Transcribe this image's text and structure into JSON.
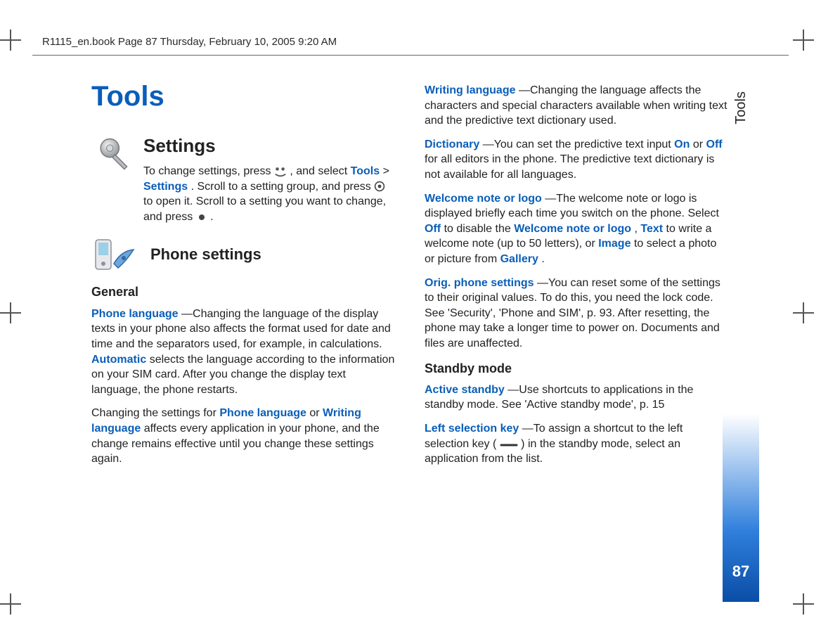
{
  "header": {
    "running_header": "R1115_en.book  Page 87  Thursday, February 10, 2005  9:20 AM"
  },
  "sidebar": {
    "section_label": "Tools",
    "page_number": "87"
  },
  "title": "Tools",
  "col1": {
    "settings_heading": "Settings",
    "settings_intro_1": "To change settings, press ",
    "settings_intro_2": ", and select ",
    "tools_word": "Tools",
    "gt": " > ",
    "settings_word": "Settings",
    "settings_intro_3": ". Scroll to a setting group, and press ",
    "settings_intro_4": " to open it. Scroll to a setting you want to change, and press ",
    "settings_intro_5": ".",
    "phone_settings_heading": "Phone settings",
    "general_heading": "General",
    "phone_language_label": "Phone language",
    "phone_language_text_1": "—Changing the language of the display texts in your phone also affects the format used for date and time and the separators used, for example, in calculations. ",
    "automatic_label": "Automatic",
    "phone_language_text_2": " selects the language according to the information on your SIM card. After you change the display text language, the phone restarts.",
    "changing_settings_1": "Changing the settings for ",
    "phone_language_label2": "Phone language",
    "or_word": " or ",
    "writing_language_label": "Writing language",
    "changing_settings_2": " affects every application in your phone, and the change remains effective until you change these settings again."
  },
  "col2": {
    "writing_language_label": "Writing language",
    "writing_language_text": "—Changing the language affects the characters and special characters available when writing text and the predictive text dictionary used.",
    "dictionary_label": "Dictionary",
    "dictionary_text_1": "—You can set the predictive text input ",
    "on_word": "On",
    "dict_or": " or ",
    "off_word": "Off",
    "dictionary_text_2": " for all editors in the phone. The predictive text dictionary is not available for all languages.",
    "welcome_label": "Welcome note or logo",
    "welcome_text_1": "—The welcome note or logo is displayed briefly each time you switch on the phone. Select ",
    "off_word2": "Off",
    "welcome_text_2": " to disable the ",
    "welcome_label2": "Welcome note or logo",
    "welcome_text_3": ", ",
    "text_word": "Text",
    "welcome_text_4": " to write a welcome note (up to 50 letters), or ",
    "image_word": "Image",
    "welcome_text_5": " to select a photo or picture from ",
    "gallery_word": "Gallery",
    "welcome_text_6": ".",
    "orig_label": "Orig. phone settings",
    "orig_text": "—You can reset some of the settings to their original values. To do this, you need the lock code. See 'Security', 'Phone and SIM', p. 93. After resetting, the phone may take a longer time to power on. Documents and files are unaffected.",
    "standby_heading": "Standby mode",
    "active_standby_label": "Active standby",
    "active_standby_text": "—Use shortcuts to applications in the standby mode. See 'Active standby mode', p. 15",
    "left_sel_label": "Left selection key",
    "left_sel_text_1": "—To assign a shortcut to the left selection key (",
    "left_sel_text_2": ") in the standby mode, select an application from the list."
  }
}
